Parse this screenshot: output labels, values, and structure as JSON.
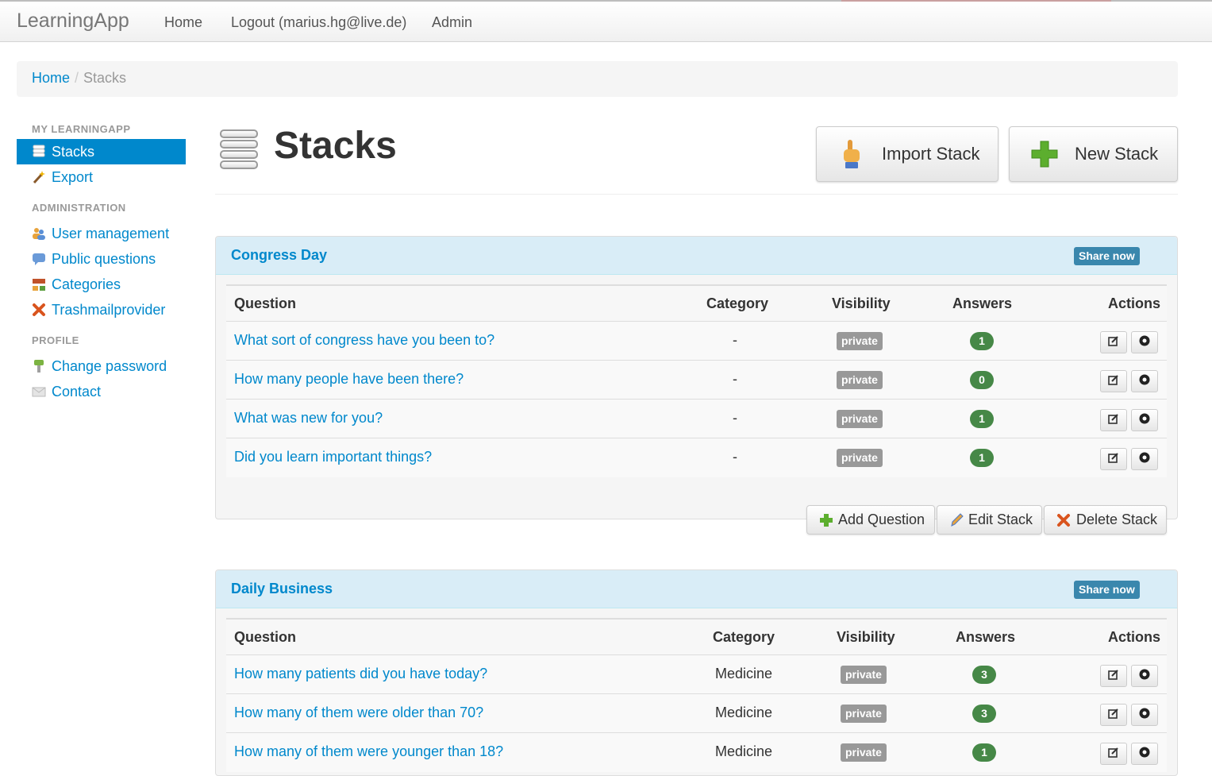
{
  "topbar": {
    "brand": "LearningApp",
    "nav": [
      "Home",
      "Logout (marius.hg@live.de)",
      "Admin"
    ]
  },
  "breadcrumb": {
    "home": "Home",
    "separator": "/",
    "current": "Stacks"
  },
  "sidebar": {
    "sections": [
      {
        "header": "MY LEARNINGAPP",
        "items": [
          {
            "label": "Stacks",
            "icon": "database-icon",
            "active": true
          },
          {
            "label": "Export",
            "icon": "wand-icon"
          }
        ]
      },
      {
        "header": "ADMINISTRATION",
        "items": [
          {
            "label": "User management",
            "icon": "users-icon"
          },
          {
            "label": "Public questions",
            "icon": "comment-icon"
          },
          {
            "label": "Categories",
            "icon": "sitemap-icon"
          },
          {
            "label": "Trashmailprovider",
            "icon": "cross-icon"
          }
        ]
      },
      {
        "header": "PROFILE",
        "items": [
          {
            "label": "Change password",
            "icon": "key-icon"
          },
          {
            "label": "Contact",
            "icon": "mail-icon"
          }
        ]
      }
    ]
  },
  "page": {
    "title": "Stacks",
    "import_label": "Import Stack",
    "new_label": "New Stack"
  },
  "table_headers": [
    "Question",
    "Category",
    "Visibility",
    "Answers",
    "Actions"
  ],
  "stacks": [
    {
      "name": "Congress Day",
      "share": "Share now",
      "questions": [
        {
          "q": "What sort of congress have you been to?",
          "category": "-",
          "visibility": "private",
          "answers": "1"
        },
        {
          "q": "How many people have been there?",
          "category": "-",
          "visibility": "private",
          "answers": "0"
        },
        {
          "q": "What was new for you?",
          "category": "-",
          "visibility": "private",
          "answers": "1"
        },
        {
          "q": "Did you learn important things?",
          "category": "-",
          "visibility": "private",
          "answers": "1"
        }
      ],
      "buttons": {
        "add": "Add Question",
        "edit": "Edit Stack",
        "delete": "Delete Stack"
      }
    },
    {
      "name": "Daily Business",
      "share": "Share now",
      "questions": [
        {
          "q": "How many patients did you have today?",
          "category": "Medicine",
          "visibility": "private",
          "answers": "3"
        },
        {
          "q": "How many of them were older than 70?",
          "category": "Medicine",
          "visibility": "private",
          "answers": "3"
        },
        {
          "q": "How many of them were younger than 18?",
          "category": "Medicine",
          "visibility": "private",
          "answers": "1"
        }
      ]
    }
  ],
  "colors": {
    "link": "#0088cc",
    "badge_green": "#468847",
    "label_gray": "#999999",
    "panel_head": "#d9edf7",
    "share_blue": "#3a87ad"
  }
}
